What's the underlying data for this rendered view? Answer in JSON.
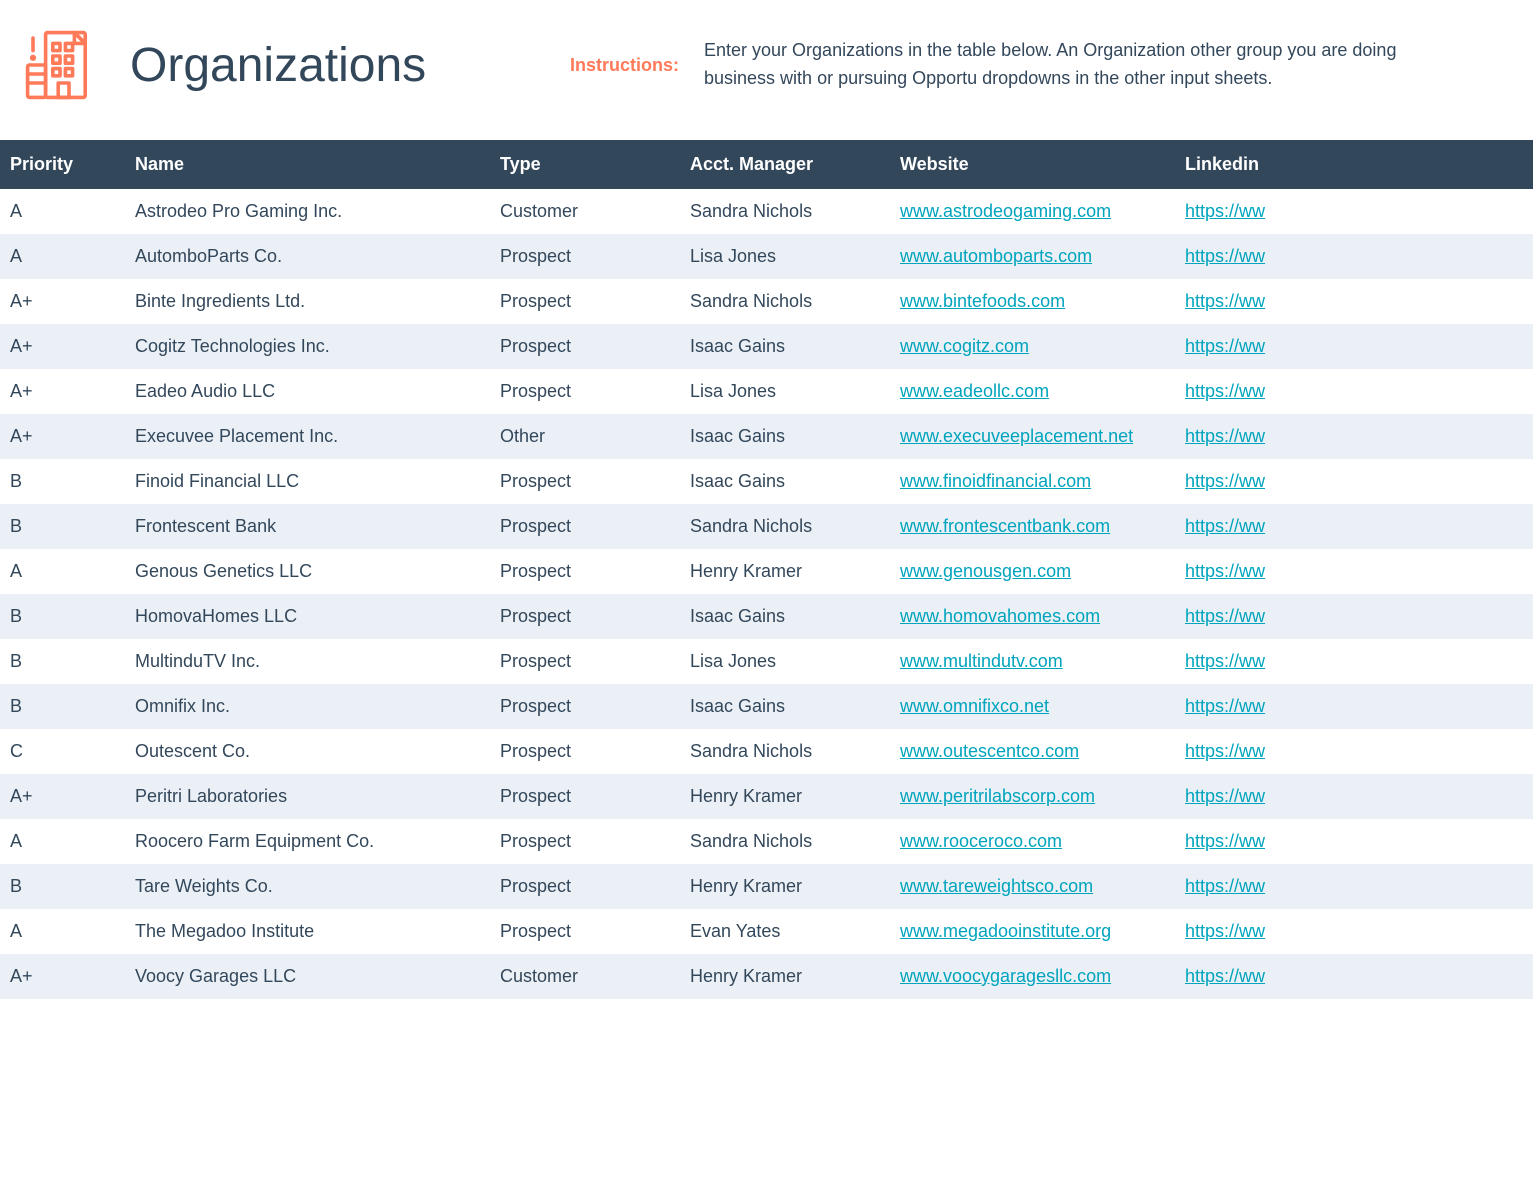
{
  "header": {
    "title": "Organizations",
    "instructions_label": "Instructions:",
    "instructions_text": "Enter your Organizations in the table below. An Organization other group you are doing business with or pursuing Opportu dropdowns in the other input sheets."
  },
  "columns": {
    "priority": "Priority",
    "name": "Name",
    "type": "Type",
    "manager": "Acct. Manager",
    "website": "Website",
    "linkedin": "Linkedin"
  },
  "linkedin_truncated": "https://ww",
  "rows": [
    {
      "priority": "A",
      "name": "Astrodeo Pro Gaming Inc.",
      "type": "Customer",
      "manager": "Sandra Nichols",
      "website": "www.astrodeogaming.com"
    },
    {
      "priority": "A",
      "name": "AutomboParts Co.",
      "type": "Prospect",
      "manager": "Lisa Jones",
      "website": "www.automboparts.com"
    },
    {
      "priority": "A+",
      "name": "Binte Ingredients Ltd.",
      "type": "Prospect",
      "manager": "Sandra Nichols",
      "website": "www.bintefoods.com"
    },
    {
      "priority": "A+",
      "name": "Cogitz Technologies Inc.",
      "type": "Prospect",
      "manager": "Isaac Gains",
      "website": "www.cogitz.com"
    },
    {
      "priority": "A+",
      "name": "Eadeo Audio LLC",
      "type": "Prospect",
      "manager": "Lisa Jones",
      "website": "www.eadeollc.com"
    },
    {
      "priority": "A+",
      "name": "Execuvee Placement Inc.",
      "type": "Other",
      "manager": "Isaac Gains",
      "website": "www.execuveeplacement.net"
    },
    {
      "priority": "B",
      "name": "Finoid Financial LLC",
      "type": "Prospect",
      "manager": "Isaac Gains",
      "website": "www.finoidfinancial.com"
    },
    {
      "priority": "B",
      "name": "Frontescent Bank",
      "type": "Prospect",
      "manager": "Sandra Nichols",
      "website": "www.frontescentbank.com"
    },
    {
      "priority": "A",
      "name": "Genous Genetics LLC",
      "type": "Prospect",
      "manager": "Henry Kramer",
      "website": "www.genousgen.com"
    },
    {
      "priority": "B",
      "name": "HomovaHomes LLC",
      "type": "Prospect",
      "manager": "Isaac Gains",
      "website": "www.homovahomes.com"
    },
    {
      "priority": "B",
      "name": "MultinduTV Inc.",
      "type": "Prospect",
      "manager": "Lisa Jones",
      "website": "www.multindutv.com"
    },
    {
      "priority": "B",
      "name": "Omnifix Inc.",
      "type": "Prospect",
      "manager": "Isaac Gains",
      "website": "www.omnifixco.net"
    },
    {
      "priority": "C",
      "name": "Outescent Co.",
      "type": "Prospect",
      "manager": "Sandra Nichols",
      "website": "www.outescentco.com"
    },
    {
      "priority": "A+",
      "name": "Peritri Laboratories",
      "type": "Prospect",
      "manager": "Henry Kramer",
      "website": "www.peritrilabscorp.com"
    },
    {
      "priority": "A",
      "name": "Roocero Farm Equipment Co.",
      "type": "Prospect",
      "manager": "Sandra Nichols",
      "website": "www.rooceroco.com"
    },
    {
      "priority": "B",
      "name": "Tare Weights Co.",
      "type": "Prospect",
      "manager": "Henry Kramer",
      "website": "www.tareweightsco.com"
    },
    {
      "priority": "A",
      "name": "The Megadoo Institute",
      "type": "Prospect",
      "manager": "Evan Yates",
      "website": "www.megadooinstitute.org"
    },
    {
      "priority": "A+",
      "name": "Voocy Garages LLC",
      "type": "Customer",
      "manager": "Henry Kramer",
      "website": "www.voocygaragesllc.com"
    }
  ]
}
